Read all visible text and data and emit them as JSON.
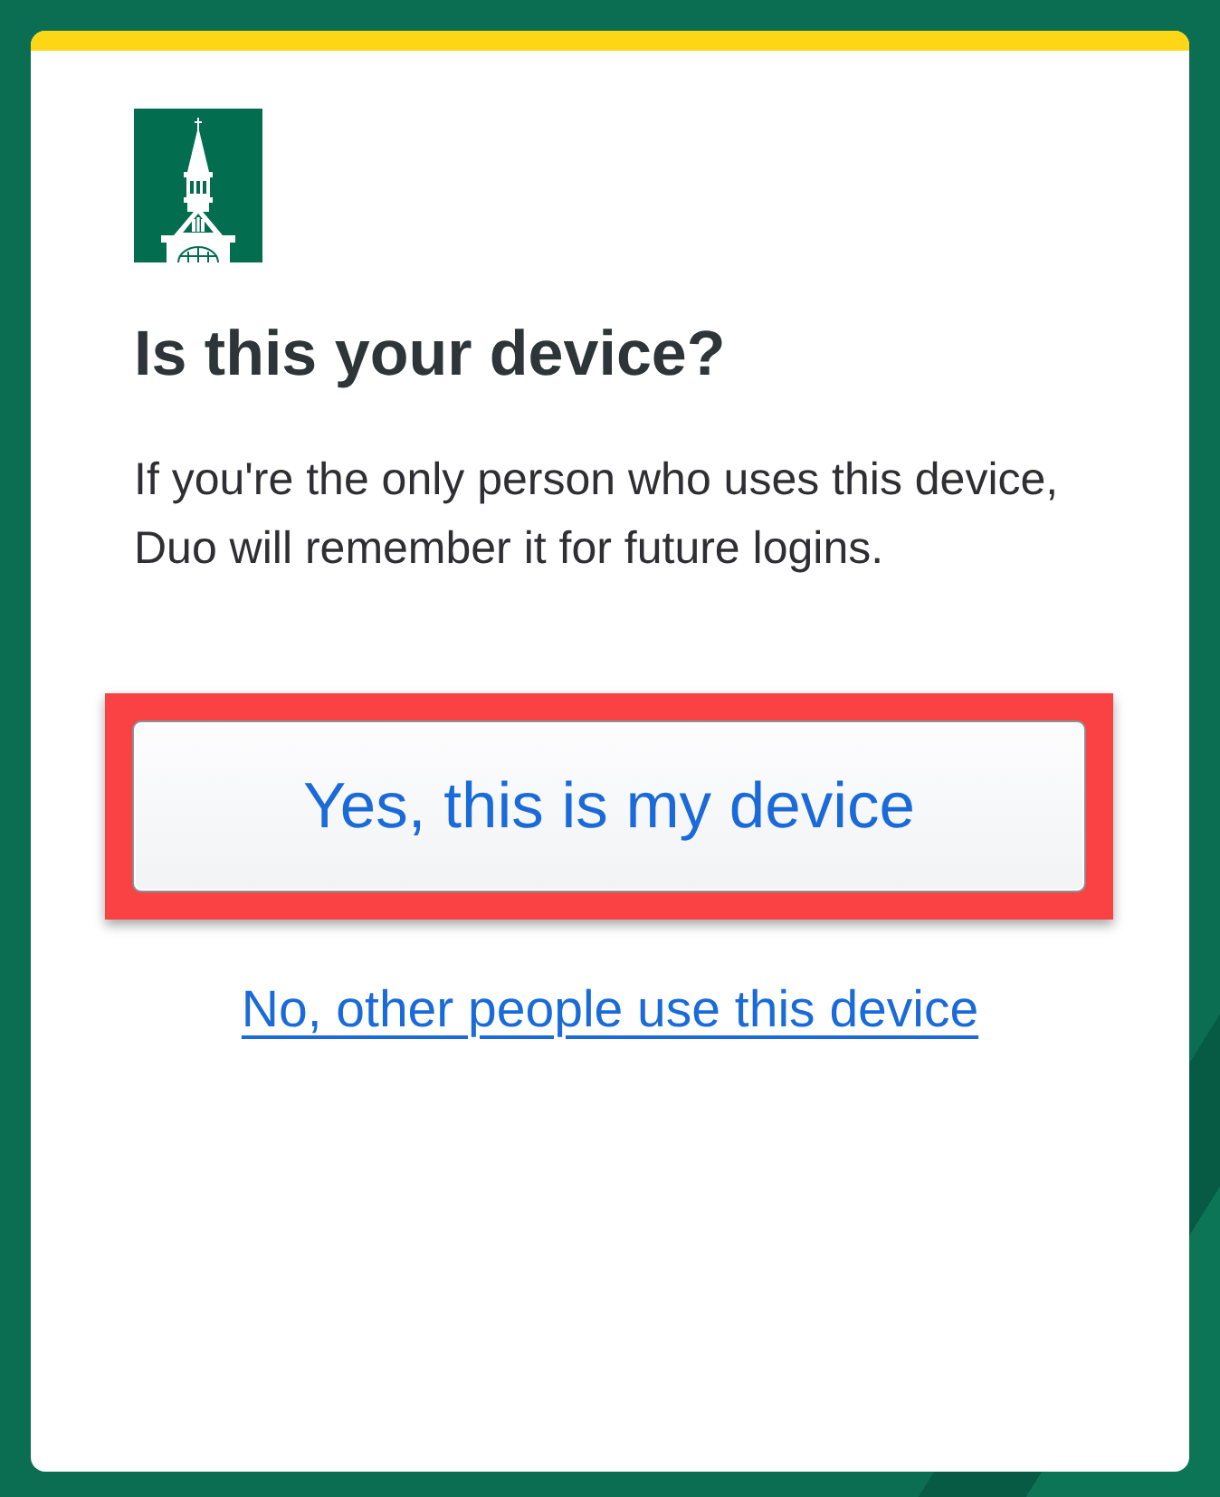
{
  "heading": "Is this your device?",
  "description": "If you're the only person who uses this device, Duo will remember it for future logins.",
  "primary_button": {
    "label": "Yes, this is my device",
    "highlighted": true
  },
  "secondary_link": {
    "label": "No, other people use this device"
  }
}
